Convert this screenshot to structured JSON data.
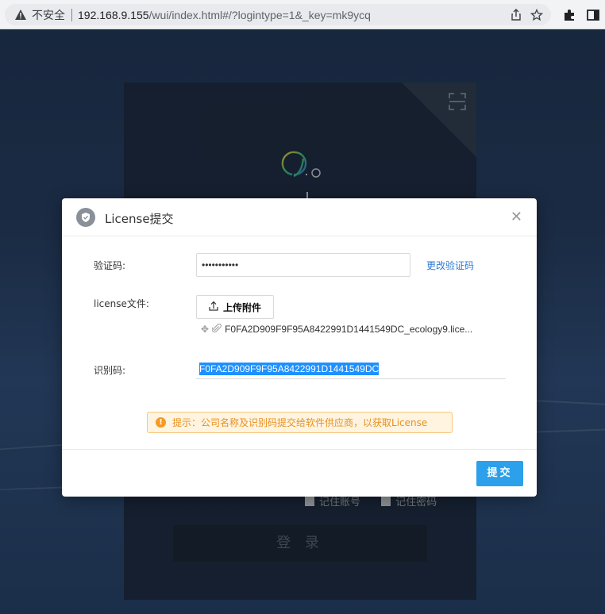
{
  "browser": {
    "insecure_label": "不安全",
    "url_host": "192.168.9.155",
    "url_path": "/wui/index.html#/?logintype=1&_key=mk9ycq"
  },
  "login": {
    "remember_account": "记住账号",
    "remember_password": "记住密码",
    "login_button": "登 录"
  },
  "dialog": {
    "title": "License提交",
    "close_symbol": "✕",
    "code_label": "验证码:",
    "code_value": "•••••••••••",
    "change_code_link": "更改验证码",
    "license_label": "license文件:",
    "upload_button": "上传附件",
    "file_name": "F0FA2D909F9F95A8422991D1441549DC_ecology9.lice...",
    "id_label": "识别码:",
    "id_value": "F0FA2D909F9F95A8422991D1441549DC",
    "tip_text": "提示：公司名称及识别码提交给软件供应商，以获取License",
    "submit_button": "提交"
  }
}
